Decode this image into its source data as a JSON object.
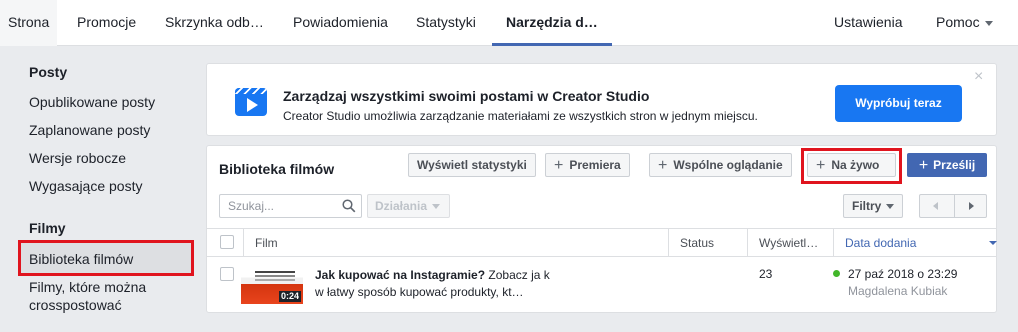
{
  "tabs": [
    {
      "label": "Strona"
    },
    {
      "label": "Promocje"
    },
    {
      "label": "Skrzynka odb…"
    },
    {
      "label": "Powiadomienia"
    },
    {
      "label": "Statystyki"
    },
    {
      "label": "Narzędzia d…",
      "active": true
    },
    {
      "label": "Ustawienia"
    },
    {
      "label": "Pomoc"
    }
  ],
  "sidebar": {
    "posts_heading": "Posty",
    "posts": [
      "Opublikowane posty",
      "Zaplanowane posty",
      "Wersje robocze",
      "Wygasające posty"
    ],
    "videos_heading": "Filmy",
    "videos": [
      "Biblioteka filmów",
      "Filmy, które można crosspostować"
    ]
  },
  "banner": {
    "title": "Zarządzaj wszystkimi swoimi postami w Creator Studio",
    "subtitle": "Creator Studio umożliwia zarządzanie materiałami ze wszystkich stron w jednym miejscu.",
    "button": "Wypróbuj teraz",
    "close": "×"
  },
  "library": {
    "title": "Biblioteka filmów",
    "stats_button": "Wyświetl statystyki",
    "premiere_button": "Premiera",
    "watch_party_button": "Wspólne oglądanie",
    "live_button": "Na żywo",
    "upload_button": "Prześlij",
    "search_placeholder": "Szukaj...",
    "actions_button": "Działania",
    "filters_button": "Filtry"
  },
  "table": {
    "columns": [
      "Film",
      "Status",
      "Wyświetl…",
      "Data dodania"
    ],
    "rows": [
      {
        "title_bold": "Jak kupować na Instagramie?",
        "title_rest": " Zobacz ja k w łatwy sposób kupować produkty, kt…",
        "duration": "0:24",
        "status": "",
        "views": "23",
        "date": "27 paź 2018 o 23:29",
        "author": "Magdalena Kubiak"
      }
    ]
  },
  "colors": {
    "accent": "#4267b2",
    "primary_button": "#1877f2",
    "highlight": "#e0141e",
    "published_dot": "#42b72a"
  }
}
